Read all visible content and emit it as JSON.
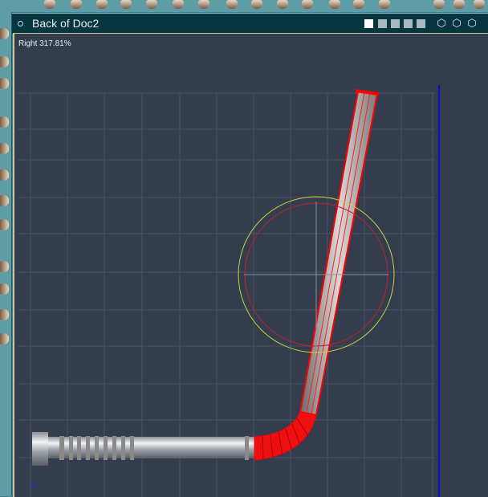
{
  "window": {
    "title": "Back of Doc2"
  },
  "viewport": {
    "camera_label": "Right 317.81%",
    "axis_label": "Z"
  },
  "icons": {
    "toolbar": [
      "sphere-tool",
      "bone-tool",
      "morph-tool",
      "scissors-tool",
      "magnet-tool",
      "crop-tool",
      "book-tool",
      "lamp-tool",
      "sculpt-tool",
      "goblet-tool",
      "envelope-tool",
      "shield-tool",
      "wing-tool",
      "blob-tool",
      "pen-tool",
      "figure-tool"
    ],
    "layouts": [
      "single-view",
      "two-view-horizontal",
      "two-view-grid",
      "four-view",
      "three-view"
    ],
    "cameras": [
      "camera-1-icon",
      "camera-2-icon",
      "camera-3-icon"
    ]
  },
  "colors": {
    "selection": "#ff0000",
    "background": "#343d4e",
    "titlebar": "#073642",
    "axis_line": "#0000ee",
    "rotate_ring": "#c8d23c"
  }
}
